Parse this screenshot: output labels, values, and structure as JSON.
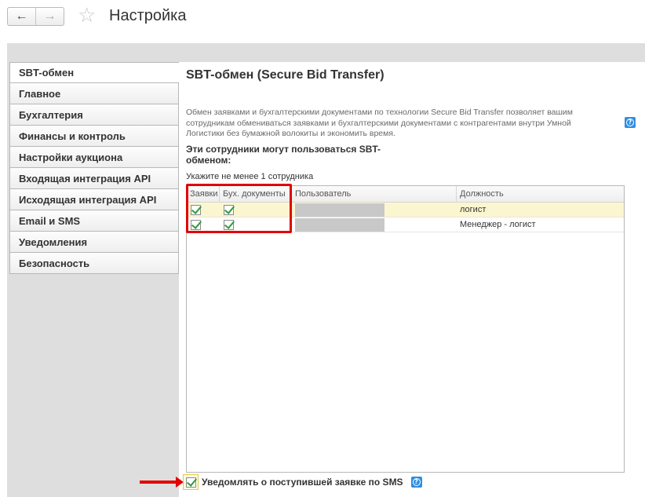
{
  "header": {
    "title": "Настройка",
    "back_icon": "←",
    "forward_icon": "→",
    "star_icon": "☆"
  },
  "sidebar": {
    "items": [
      {
        "label": "SBT-обмен",
        "active": true
      },
      {
        "label": "Главное"
      },
      {
        "label": "Бухгалтерия"
      },
      {
        "label": "Финансы и контроль"
      },
      {
        "label": "Настройки аукциона"
      },
      {
        "label": "Входящая интеграция API"
      },
      {
        "label": "Исходящая интеграция API"
      },
      {
        "label": "Email и SMS"
      },
      {
        "label": "Уведомления"
      },
      {
        "label": "Безопасность"
      }
    ]
  },
  "main": {
    "title": "SBT-обмен (Secure Bid Transfer)",
    "description": "Обмен заявками и бухгалтерскими документами по технологии Secure Bid Transfer  позволяет вашим сотрудникам обмениваться заявками и бухгалтерскими документами с контрагентами внутри Умной Логистики без бумажной волокиты и экономить время.",
    "section_heading": "Эти сотрудники могут пользоваться SBT-обменом:",
    "hint": "Укажите не менее 1 сотрудника",
    "table": {
      "columns": [
        "Заявки",
        "Бух. документы",
        "Пользователь",
        "Должность"
      ],
      "rows": [
        {
          "requests": true,
          "accounting": true,
          "user": "",
          "position": "логист",
          "selected": true
        },
        {
          "requests": true,
          "accounting": true,
          "user": "",
          "position": "Менеджер - логист",
          "selected": false
        }
      ]
    },
    "sms_checkbox": {
      "label": "Уведомлять о поступившей заявке по SMS",
      "checked": true
    }
  },
  "colors": {
    "highlight_red": "#e30000",
    "help_blue": "#2f8fe0",
    "check_green": "#2e9b3d",
    "selected_row": "#fbf6cf"
  }
}
